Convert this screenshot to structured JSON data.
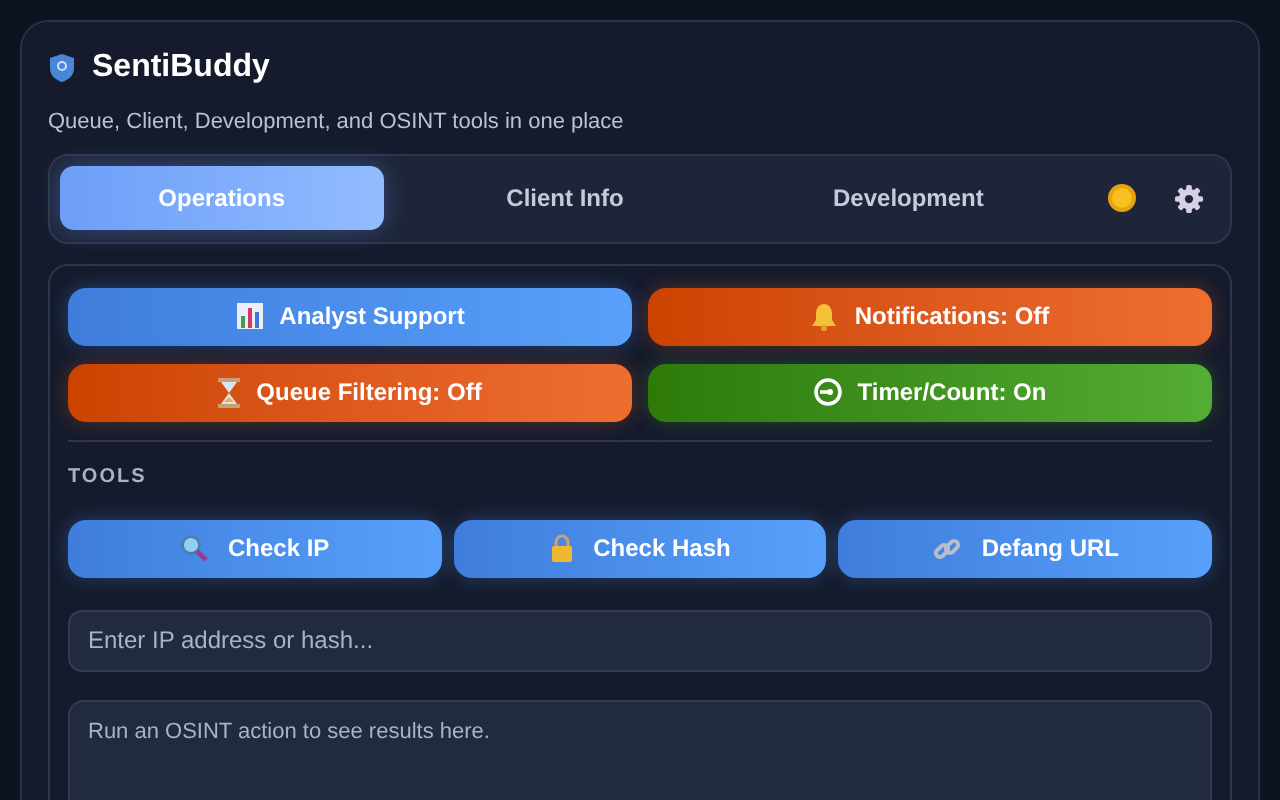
{
  "app": {
    "title": "SentiBuddy",
    "subtitle": "Queue, Client, Development, and OSINT tools in one place"
  },
  "tabs": [
    {
      "label": "Operations",
      "selected": true
    },
    {
      "label": "Client Info",
      "selected": false
    },
    {
      "label": "Development",
      "selected": false
    }
  ],
  "quick_actions": [
    {
      "kind": "action",
      "label": "Analyst Support"
    },
    {
      "kind": "toggle",
      "label": "Notifications: Off",
      "on": false
    },
    {
      "kind": "toggle",
      "label": "Queue Filtering: Off",
      "on": false
    },
    {
      "kind": "toggle",
      "label": "Timer/Count: On",
      "on": true
    }
  ],
  "tools": {
    "heading": "TOOLS",
    "buttons": [
      {
        "label": "Check IP"
      },
      {
        "label": "Check Hash"
      },
      {
        "label": "Defang URL"
      }
    ],
    "input": {
      "placeholder": "Enter IP address or hash..."
    },
    "output": {
      "placeholder": "Run an OSINT action to see results here."
    }
  }
}
